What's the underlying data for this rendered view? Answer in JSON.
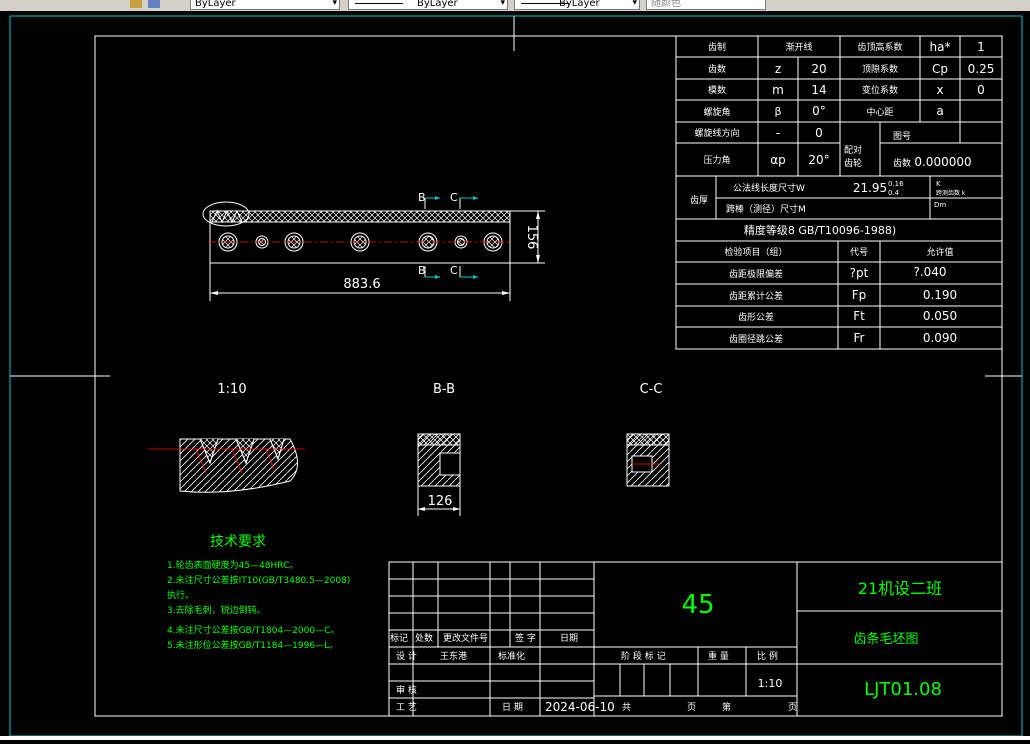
{
  "toolbar": {
    "layer_combo": "ByLayer",
    "linetype_combo": "ByLayer",
    "lineweight_combo": "ByLayer",
    "color_combo": "随颜色"
  },
  "colors": {
    "background": "#000000",
    "drawing_white": "#ffffff",
    "border_cyan": "#00c8c8",
    "green": "#00ff00",
    "red": "#ff0000"
  },
  "drawing": {
    "main_view": {
      "overall_length": "883.6",
      "height": "156",
      "section_b": "B",
      "section_c": "C"
    },
    "detail_labels": {
      "scale_view": "1:10",
      "section_bb": "B-B",
      "section_cc": "C-C"
    },
    "section_bb_width": "126",
    "param_table": {
      "rows": [
        {
          "label": "齿制",
          "value": "渐开线",
          "label2": "齿顶高系数",
          "sym": "ha*",
          "val": "1"
        },
        {
          "label": "齿数",
          "sym1": "z",
          "val1": "20",
          "label2": "顶隙系数",
          "sym": "Cp",
          "val": "0.25"
        },
        {
          "label": "模数",
          "sym1": "m",
          "val1": "14",
          "label2": "变位系数",
          "sym": "x",
          "val": "0"
        },
        {
          "label": "螺旋角",
          "sym1": "β",
          "val1": "0°",
          "label2": "中心距",
          "sym": "a",
          "val": ""
        },
        {
          "label": "螺旋线方向",
          "sym1": "-",
          "val1": "0",
          "label2": "配对",
          "sym": "图号",
          "val": ""
        },
        {
          "label": "压力角",
          "sym1": "αp",
          "val1": "20°",
          "label2": "齿轮",
          "sym": "齿数",
          "val": "0.000000"
        }
      ],
      "span_label": "齿厚",
      "common_normal": "公法线长度尺寸W",
      "common_normal_val": "21.95",
      "tol_upper": "0.16",
      "tol_lower": "0.4",
      "k_label": "K",
      "k_note": "跨测齿数 k",
      "dm_label": "Dm",
      "measuring_ball": "跨棒（测径）尺寸M",
      "accuracy": "精度等级8 GB/T10096-1988)",
      "inspection_header": "检验项目（组）",
      "code_header": "代号",
      "tolerance_header": "允许值",
      "items": [
        {
          "name": "齿距极限偏差",
          "code": "?pt",
          "value": "?.040"
        },
        {
          "name": "齿距累计公差",
          "code": "Fp",
          "value": "0.190"
        },
        {
          "name": "齿形公差",
          "code": "Ft",
          "value": "0.050"
        },
        {
          "name": "齿圈径跳公差",
          "code": "Fr",
          "value": "0.090"
        }
      ]
    },
    "tech_req": {
      "title": "技术要求",
      "lines": [
        "1.轮齿表面硬度为45—48HRC。",
        "2.未注尺寸公差按IT10(GB/T3480.5—2008)",
        "   执行。",
        "3.去除毛刺，锐边倒钝。",
        "4.未注尺寸公差按GB/T1804—2000—C。",
        "5.未注形位公差按GB/T1184—1996—L。"
      ]
    },
    "title_block": {
      "material": "45",
      "company": "21机设二班",
      "drawing_name": "齿条毛坯图",
      "drawing_no": "LJT01.08",
      "scale": "1:10",
      "date": "2024-06-10",
      "mark_label": "标记",
      "count_label": "处数",
      "change_doc_label": "更改文件号",
      "sign_label": "签 字",
      "date_label": "日期",
      "design_label": "设 计",
      "review_label": "审 核",
      "process_label": "工 艺",
      "std_label": "标准化",
      "std_check": "标准化",
      "stage_label": "阶 段 标 记",
      "weight_label": "重 量",
      "scale_label": "比 例",
      "sheet_label": "共",
      "page_label": "页",
      "no_label": "第",
      "page_label2": "页",
      "date_label2": "日 期",
      "designer": "王东港"
    }
  }
}
